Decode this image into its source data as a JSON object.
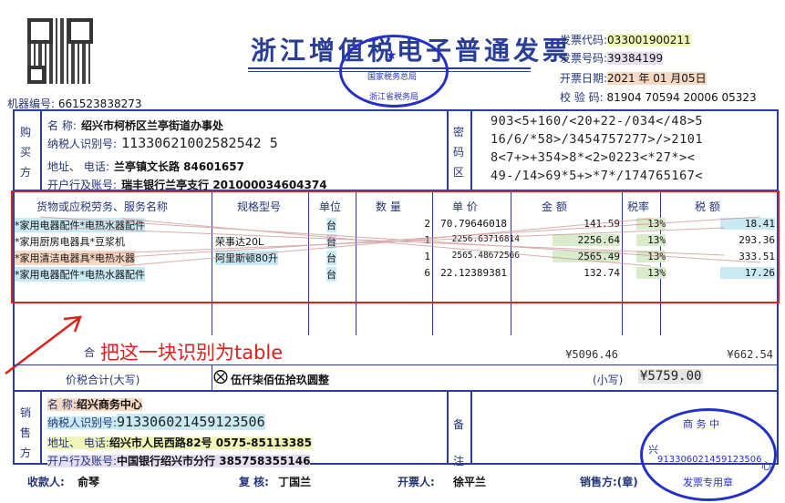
{
  "header": {
    "title": "浙江增值税电子普通发票",
    "machine_no_label": "机器编号:",
    "machine_no": "661523838273",
    "invoice_code_label": "发票代码:",
    "invoice_code": "033001900211",
    "invoice_no_label": "发票号码:",
    "invoice_no": "39384199",
    "date_label": "开票日期:",
    "date": "2021 年 01 月05日",
    "check_label": "校  验  码:",
    "check_code": "81904 70594 20006 05323"
  },
  "buyer": {
    "side_label": [
      "购",
      "买",
      "方"
    ],
    "name_label": "名        称:",
    "name": "绍兴市柯桥区兰亭街道办事处",
    "tax_label": "纳税人识别号:",
    "tax_id": "11330621002582542 5",
    "addr_label": "地址、    电话:",
    "addr": "兰亭镇文长路 84601657",
    "bank_label": "开户行及账号:",
    "bank": "瑞丰银行兰亭支行 201000034604374"
  },
  "cipher": {
    "side_label": [
      "密",
      "码",
      "区"
    ],
    "lines": [
      "903<5+160/<20+22-/034</48>5",
      "16/6/*58>/3454757277>/>2101",
      "8<7+>+354>8*<2>0223<*27*><",
      "49-/14>69*5+>*7*/174765167<"
    ]
  },
  "table": {
    "headers": [
      "货物或应税劳务、服务名称",
      "规格型号",
      "单位",
      "数 量",
      "单 价",
      "金 额",
      "税率",
      "税 额"
    ],
    "rows": [
      {
        "name": "*家用电器配件*电热水器配件",
        "spec": "",
        "unit": "台",
        "qty": "2",
        "price": "70.79646018",
        "amount": "141.59",
        "rate": "13%",
        "tax": "18.41"
      },
      {
        "name": "*家用厨房电器具*豆浆机",
        "spec": "荣事达20L",
        "unit": "台",
        "qty": "1",
        "price": "2256.63716814",
        "amount": "2256.64",
        "rate": "13%",
        "tax": "293.36"
      },
      {
        "name": "*家用清洁电器具*电热水器",
        "spec": "阿里斯顿80升",
        "unit": "台",
        "qty": "1",
        "price": "2565.48672566",
        "amount": "2565.49",
        "rate": "13%",
        "tax": "333.51"
      },
      {
        "name": "*家用电器配件*电热水器配件",
        "spec": "",
        "unit": "台",
        "qty": "6",
        "price": "22.12389381",
        "amount": "132.74",
        "rate": "13%",
        "tax": "17.26"
      }
    ],
    "total_label": "合",
    "total_amount": "¥5096.46",
    "total_tax": "¥662.54"
  },
  "annotation": {
    "text": "把这一块识别为table",
    "color": "#e0201c"
  },
  "grand_total": {
    "label": "价税合计(大写)",
    "upper_symbol": "⨂",
    "upper": "伍仟柒佰伍拾玖圆整",
    "lower_label": "(小写)",
    "lower": "¥5759.00"
  },
  "seller": {
    "side_label": [
      "销",
      "售",
      "方"
    ],
    "name_label": "名        称:",
    "name": "绍兴商务中心",
    "tax_label": "纳税人识别号:",
    "tax_id": "913306021459123506",
    "addr_label": "地址、    电话:",
    "addr": "绍兴市人民西路82号 0575-85113385",
    "bank_label": "开户行及账号:",
    "bank": "中国银行绍兴市分行 385758355146"
  },
  "remarks": {
    "side_label": [
      "备",
      "注"
    ]
  },
  "stamps": {
    "tax_bureau_top": "国家税务总局",
    "tax_bureau_bottom": "浙江省税务局",
    "seller_stamp_top": "商  务  中",
    "seller_stamp_id": "913306021459123506",
    "seller_stamp_bottom": "发票专用章",
    "seller_stamp_left": "兴",
    "seller_stamp_right": "心",
    "stamp_color": "#2530c8"
  },
  "footer": {
    "payee_label": "收款人:",
    "payee": "俞琴",
    "reviewer_label": "复  核:",
    "reviewer": "丁国兰",
    "issuer_label": "开票人:",
    "issuer": "徐平兰",
    "seller_label": "销售方:(章)"
  },
  "colors": {
    "frame": "#2a3e96",
    "highlight_yellow": "#eef5b5",
    "highlight_cyan": "#c9e9f3",
    "highlight_orange": "#f6d9c3",
    "highlight_purple": "#e6dff2",
    "highlight_green": "#d8ebcb"
  }
}
